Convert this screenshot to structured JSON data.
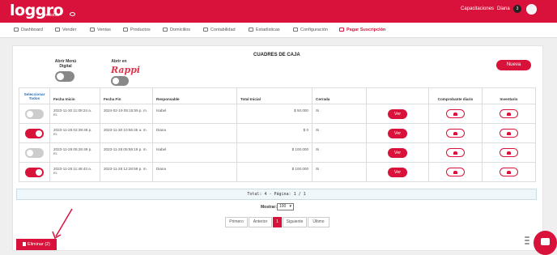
{
  "app": {
    "logo_text": "loggro",
    "logo_sub": "restobar"
  },
  "topbar": {
    "link": "Capacitaciones",
    "user_name": "Diana",
    "notif_count": "3"
  },
  "menu": [
    {
      "label": "Dashboard",
      "icon": "dashboard-icon"
    },
    {
      "label": "Vender",
      "icon": "scissors-icon"
    },
    {
      "label": "Ventas",
      "icon": "cart-icon"
    },
    {
      "label": "Productos",
      "icon": "box-icon"
    },
    {
      "label": "Domicilios",
      "icon": "bike-icon"
    },
    {
      "label": "Contabilidad",
      "icon": "ledger-icon"
    },
    {
      "label": "Estadísticas",
      "icon": "chart-line-icon"
    },
    {
      "label": "Configuración",
      "icon": "gear-icon"
    },
    {
      "label": "Pagar Suscripción",
      "icon": "card-icon"
    }
  ],
  "page": {
    "title": "CUADRES DE CAJA",
    "new_button": "Nueva"
  },
  "toggles": {
    "menu_digital": "Abrir Menú Digital",
    "rappi_label": "Abrir en",
    "rappi_brand": "Rappi"
  },
  "table": {
    "headers": [
      "Seleccionar Todos",
      "Fecha Inicio",
      "Fecha Fin",
      "Responsable",
      "Total Inicial",
      "Cerrada",
      "",
      "Comprobante diario",
      "Inventario"
    ],
    "action_label": "Ver",
    "rows": [
      {
        "selected": false,
        "inicio": "2023-11-30 11:09:24 a. m.",
        "fin": "2024-02-19 05:15:55 p. m.",
        "responsable": "Isabel",
        "total": "$ 50.000",
        "cerrada": "Si"
      },
      {
        "selected": true,
        "inicio": "2023-11-28 02:39:48 p. m.",
        "fin": "2023-11-30 10:56:45 a. m.",
        "responsable": "Diana",
        "total": "$ 0",
        "cerrada": "Si"
      },
      {
        "selected": false,
        "inicio": "2023-11-28 05:26:49 p. m.",
        "fin": "2023-11-28 05:59:19 p. m.",
        "responsable": "Isabel",
        "total": "$ 100.000",
        "cerrada": "Si"
      },
      {
        "selected": true,
        "inicio": "2023-11-28 11:48:43 a. m.",
        "fin": "2023-11-28 12:28:59 p. m.",
        "responsable": "Diana",
        "total": "$ 100.000",
        "cerrada": "Si"
      }
    ]
  },
  "footer": {
    "total_text": "Total: 4 - Página: 1 / 1",
    "mostrar_label": "Mostrar:",
    "mostrar_value": "100",
    "pager": {
      "first": "Primero",
      "prev": "Anterior",
      "current": "1",
      "next": "Siguiente",
      "last": "Último"
    },
    "delete_button": "Eliminar (2)"
  },
  "colors": {
    "accent": "#d8123a",
    "info_bar": "#f0f7fb"
  }
}
